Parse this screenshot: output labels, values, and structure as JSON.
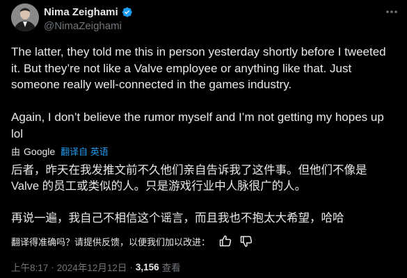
{
  "author": {
    "display_name": "Nima Zeighami",
    "handle": "@NimaZeighami"
  },
  "tweet": {
    "text": "The latter, they told me this in person yesterday shortly before I tweeted it. But they’re not like a Valve employee or anything like that. Just someone really well-connected in the games industry.\n\nAgain, I don’t believe the rumor myself and I’m not getting my hopes up lol"
  },
  "translation": {
    "by_label": "由",
    "provider": "Google",
    "source_label": "翻译自 英语",
    "text": "后者，昨天在我发推文前不久他们亲自告诉我了这件事。但他们不像是 Valve 的员工或类似的人。只是游戏行业中人脉很广的人。\n\n再说一遍，我自己不相信这个谣言，而且我也不抱太大希望，哈哈",
    "feedback_prompt": "翻译得准确吗？请提供反馈，以便我们加以改进："
  },
  "meta": {
    "time": "上午8:17",
    "date": "2024年12月12日",
    "separator": "·",
    "views_count": "3,156",
    "views_label": "查看"
  },
  "colors": {
    "background": "#000000",
    "text": "#e7e9ea",
    "muted": "#71767b",
    "accent": "#1d9bf0"
  },
  "icons": {
    "verified": "verified-badge-icon",
    "more": "more-horizontal-icon",
    "thumbs_up": "thumbs-up-icon",
    "thumbs_down": "thumbs-down-icon"
  }
}
